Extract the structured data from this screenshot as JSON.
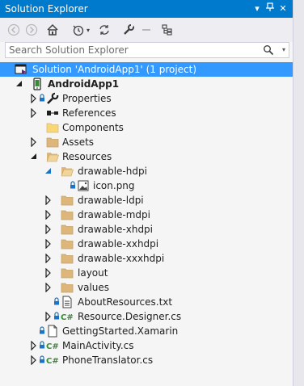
{
  "window": {
    "title": "Solution Explorer"
  },
  "toolbar": {
    "buttons": [
      "back",
      "forward",
      "home",
      "history",
      "sync",
      "properties",
      "collapse",
      "show-all-files"
    ]
  },
  "search": {
    "placeholder": "Search Solution Explorer"
  },
  "tree": {
    "solution": "Solution 'AndroidApp1' (1 project)",
    "project": "AndroidApp1",
    "items": {
      "properties": "Properties",
      "references": "References",
      "components": "Components",
      "assets": "Assets",
      "resources": "Resources",
      "drawable_hdpi": "drawable-hdpi",
      "icon_png": "icon.png",
      "drawable_ldpi": "drawable-ldpi",
      "drawable_mdpi": "drawable-mdpi",
      "drawable_xhdpi": "drawable-xhdpi",
      "drawable_xxhdpi": "drawable-xxhdpi",
      "drawable_xxxhdpi": "drawable-xxxhdpi",
      "layout": "layout",
      "values": "values",
      "about_resources": "AboutResources.txt",
      "resource_designer": "Resource.Designer.cs",
      "getting_started": "GettingStarted.Xamarin",
      "main_activity": "MainActivity.cs",
      "phone_translator": "PhoneTranslator.cs"
    }
  },
  "colors": {
    "accent": "#007acc",
    "selection": "#3399ff",
    "folder": "#dcb67a",
    "csharp": "#388a34"
  }
}
